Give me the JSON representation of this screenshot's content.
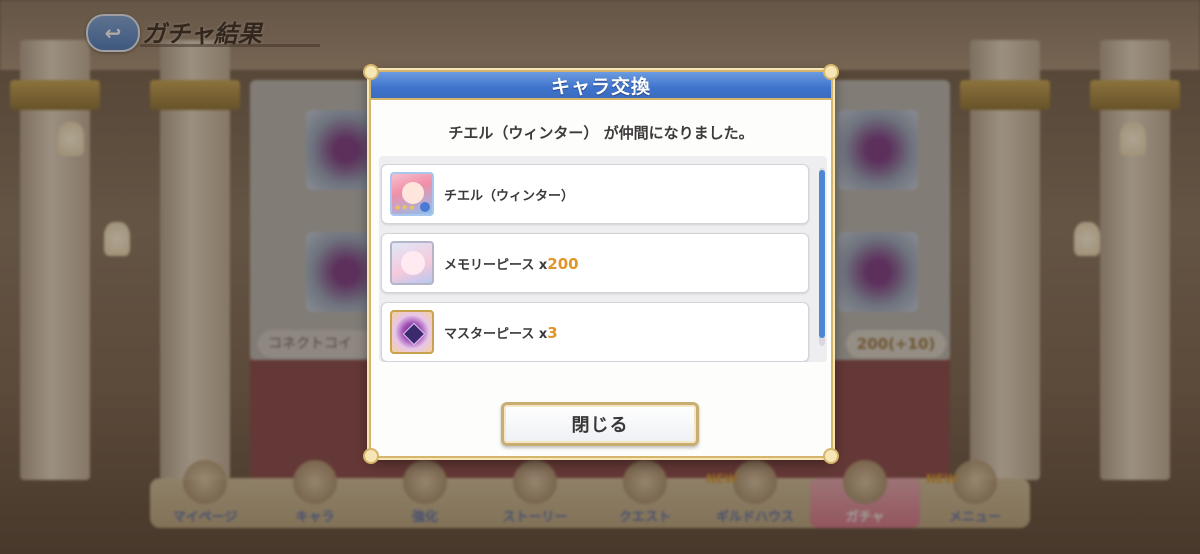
{
  "header": {
    "back_icon": "return-arrow-icon",
    "title": "ガチャ結果"
  },
  "background": {
    "coin_label": "コネクトコイ",
    "coin_count": "200(+10)"
  },
  "bottom_nav": {
    "items": [
      {
        "label": "マイページ",
        "icon": "mypage-icon"
      },
      {
        "label": "キャラ",
        "icon": "character-icon"
      },
      {
        "label": "強化",
        "icon": "enhance-icon"
      },
      {
        "label": "ストーリー",
        "icon": "story-icon"
      },
      {
        "label": "クエスト",
        "icon": "quest-icon"
      },
      {
        "label": "ギルドハウス",
        "icon": "guildhouse-icon",
        "badge": "NEW"
      },
      {
        "label": "ガチャ",
        "icon": "gacha-icon",
        "active": true
      },
      {
        "label": "メニュー",
        "icon": "menu-icon",
        "badge": "NEW"
      }
    ]
  },
  "dialog": {
    "title": "キャラ交換",
    "message": "チエル（ウィンター） が仲間になりました。",
    "items": [
      {
        "label": "チエル（ウィンター）",
        "icon": "character-portrait-icon"
      },
      {
        "label": "メモリーピース x",
        "quantity": "200",
        "icon": "memory-piece-icon"
      },
      {
        "label": "マスターピース x",
        "quantity": "3",
        "icon": "master-piece-icon"
      }
    ],
    "close_label": "閉じる"
  },
  "colors": {
    "title_bar": "#3f74cc",
    "gold_border": "#d5b56b",
    "quantity": "#e0962a",
    "scroll_thumb": "#4e86d6"
  }
}
